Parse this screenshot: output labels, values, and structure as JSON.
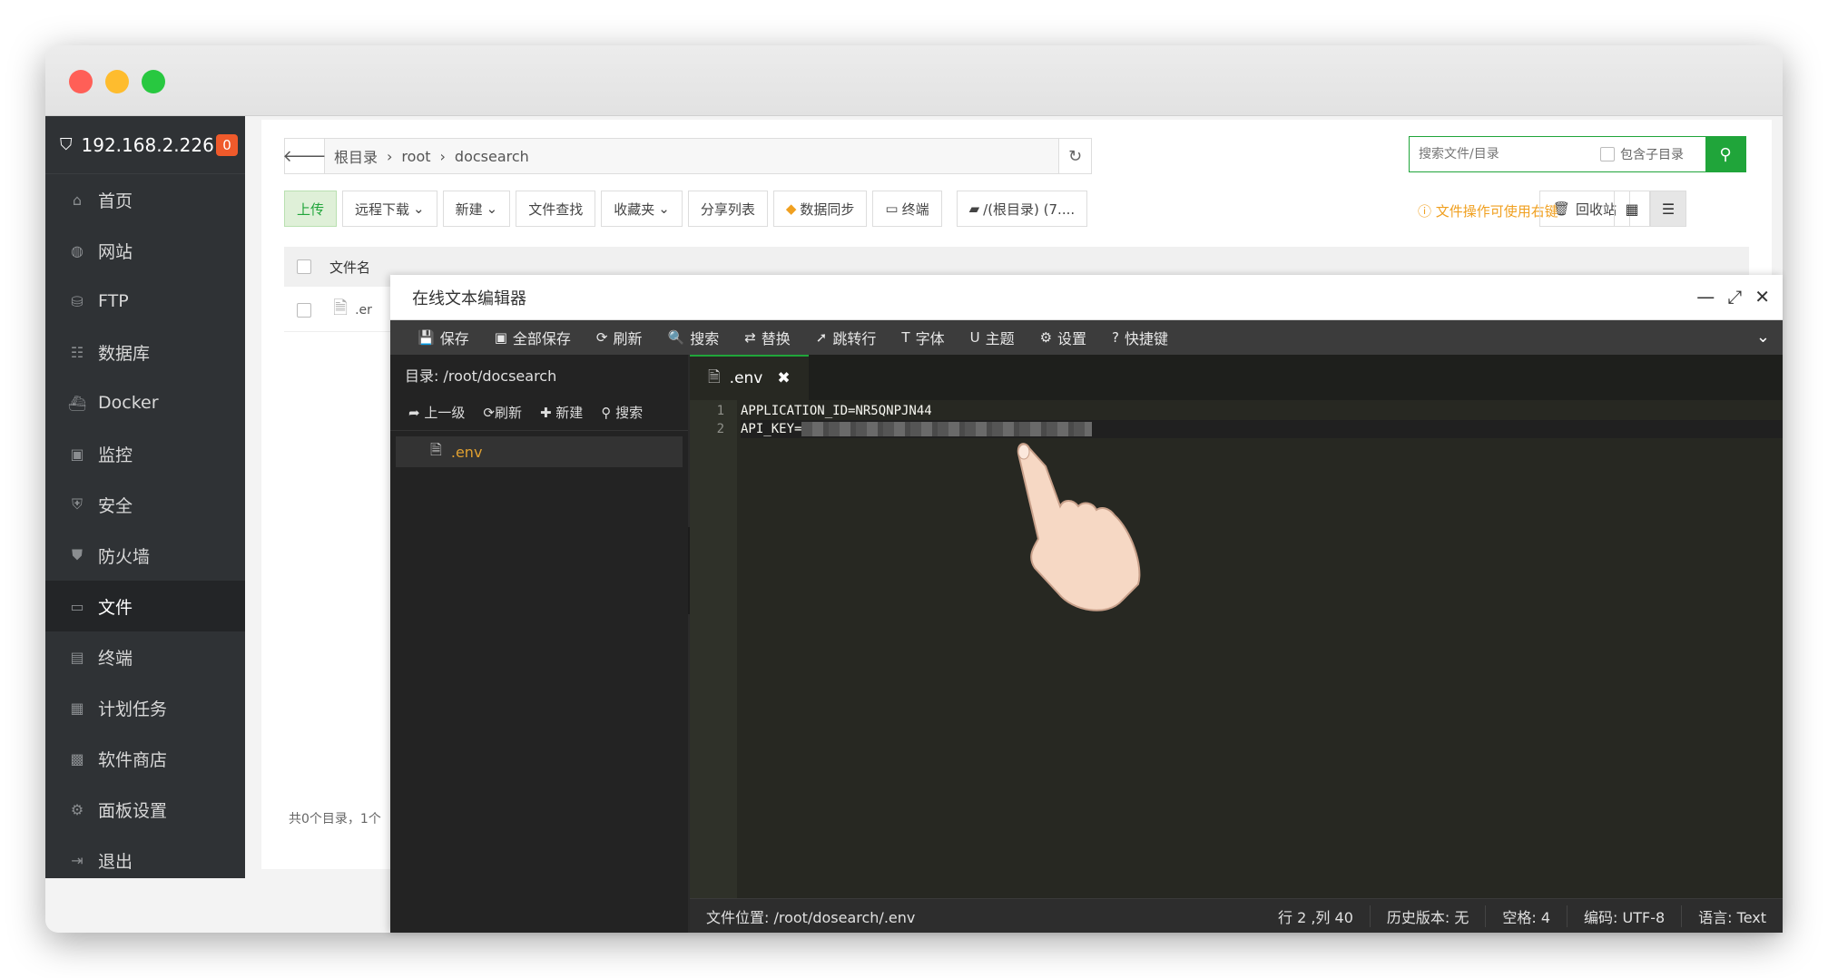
{
  "sidebar": {
    "host": "192.168.2.226",
    "badge": "0",
    "items": [
      {
        "label": "首页",
        "icon": "home-icon"
      },
      {
        "label": "网站",
        "icon": "globe-icon"
      },
      {
        "label": "FTP",
        "icon": "ftp-icon"
      },
      {
        "label": "数据库",
        "icon": "database-icon"
      },
      {
        "label": "Docker",
        "icon": "docker-icon"
      },
      {
        "label": "监控",
        "icon": "monitor-icon"
      },
      {
        "label": "安全",
        "icon": "shield-icon"
      },
      {
        "label": "防火墙",
        "icon": "firewall-icon"
      },
      {
        "label": "文件",
        "icon": "folder-icon"
      },
      {
        "label": "终端",
        "icon": "terminal-icon"
      },
      {
        "label": "计划任务",
        "icon": "calendar-icon"
      },
      {
        "label": "软件商店",
        "icon": "apps-icon"
      },
      {
        "label": "面板设置",
        "icon": "settings-icon"
      },
      {
        "label": "退出",
        "icon": "logout-icon"
      }
    ]
  },
  "path": {
    "crumbs": [
      "根目录",
      "root",
      "docsearch"
    ]
  },
  "search": {
    "placeholder": "搜索文件/目录",
    "subdir_label": "包含子目录"
  },
  "toolbar": {
    "upload": "上传",
    "remote_download": "远程下载",
    "new": "新建",
    "find": "文件查找",
    "favorites": "收藏夹",
    "share_list": "分享列表",
    "data_sync": "数据同步",
    "terminal": "终端",
    "disk": "/(根目录) (7....",
    "hint": "文件操作可使用右键",
    "recycle": "回收站"
  },
  "table": {
    "col_name": "文件名",
    "row_name": ".er",
    "footer": "共0个目录，1个"
  },
  "editor": {
    "title": "在线文本编辑器",
    "tools": [
      {
        "label": "保存",
        "glyph": "💾"
      },
      {
        "label": "全部保存",
        "glyph": "▣"
      },
      {
        "label": "刷新",
        "glyph": "⟳"
      },
      {
        "label": "搜索",
        "glyph": "🔍"
      },
      {
        "label": "替换",
        "glyph": "⇄"
      },
      {
        "label": "跳转行",
        "glyph": "➚"
      },
      {
        "label": "字体",
        "glyph": "T"
      },
      {
        "label": "主题",
        "glyph": "U"
      },
      {
        "label": "设置",
        "glyph": "⚙"
      },
      {
        "label": "快捷键",
        "glyph": "?"
      }
    ],
    "dir_label": "目录: /root/docsearch",
    "tree_tools": [
      "上一级",
      "刷新",
      "新建",
      "搜索"
    ],
    "tree_file": ".env",
    "tab_name": ".env",
    "lines": [
      {
        "num": "1",
        "text": "APPLICATION_ID=NR5QNPJN44"
      },
      {
        "num": "2",
        "text": "API_KEY="
      }
    ],
    "status": {
      "path": "文件位置: /root/dosearch/.env",
      "pos": "行 2 ,列 40",
      "history": "历史版本: 无",
      "spaces": "空格: 4",
      "encoding": "编码: UTF-8",
      "lang": "语言: Text"
    }
  }
}
